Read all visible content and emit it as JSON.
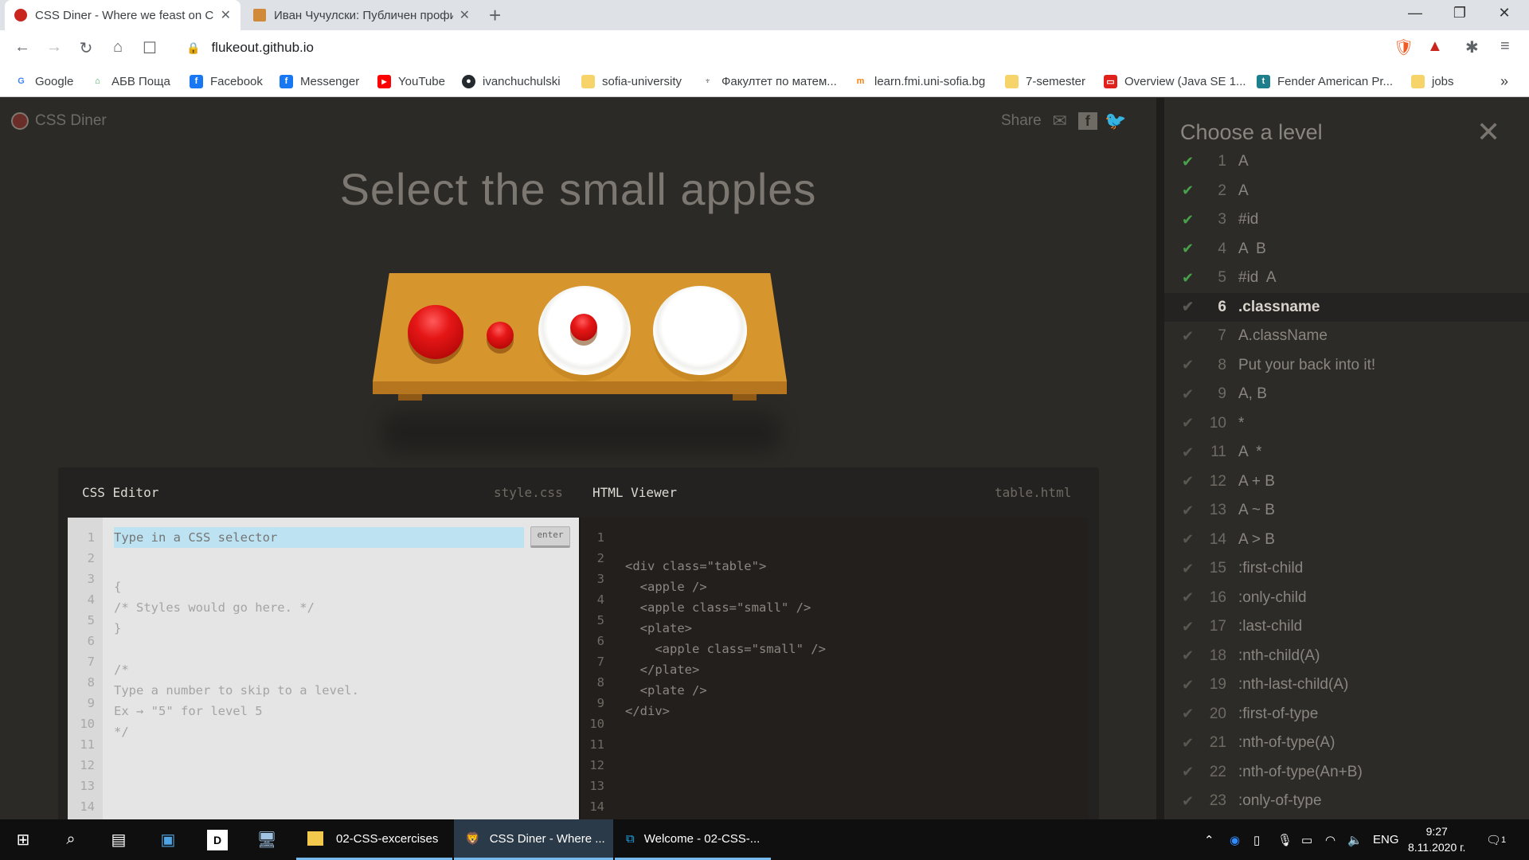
{
  "browser": {
    "tabs": [
      {
        "title": "CSS Diner - Where we feast on CSS",
        "active": true
      },
      {
        "title": "Иван Чучулски: Публичен профил",
        "active": false
      }
    ],
    "url": "flukeout.github.io",
    "bookmarks": [
      {
        "label": "Google",
        "icon": "google-icon"
      },
      {
        "label": "АБВ Поща",
        "icon": "house-icon"
      },
      {
        "label": "Facebook",
        "icon": "facebook-icon"
      },
      {
        "label": "Messenger",
        "icon": "facebook-icon"
      },
      {
        "label": "YouTube",
        "icon": "youtube-icon"
      },
      {
        "label": "ivanchuchulski",
        "icon": "github-icon"
      },
      {
        "label": "sofia-university",
        "icon": "folder-icon"
      },
      {
        "label": "Факултет по матем...",
        "icon": "university-icon"
      },
      {
        "label": "learn.fmi.uni-sofia.bg",
        "icon": "moodle-icon"
      },
      {
        "label": "7-semester",
        "icon": "folder-icon"
      },
      {
        "label": "Overview (Java SE 1...",
        "icon": "oracle-icon"
      },
      {
        "label": "Fender American Pr...",
        "icon": "tab-icon"
      },
      {
        "label": "jobs",
        "icon": "folder-icon"
      }
    ],
    "bookmarks_overflow": "»"
  },
  "page": {
    "brand": "CSS Diner",
    "share": "Share",
    "heading": "Select the small apples",
    "css_editor": {
      "title": "CSS Editor",
      "filename": "style.css",
      "placeholder": "Type in a CSS selector",
      "enter_label": "enter",
      "lines": [
        "",
        "{",
        "/* Styles would go here. */",
        "}",
        "",
        "/*",
        "Type a number to skip to a level.",
        "Ex → \"5\" for level 5",
        "*/",
        "",
        "",
        "",
        "",
        ""
      ],
      "line_numbers": [
        "1",
        "2",
        "3",
        "4",
        "5",
        "6",
        "7",
        "8",
        "9",
        "10",
        "11",
        "12",
        "13",
        "14"
      ]
    },
    "html_viewer": {
      "title": "HTML Viewer",
      "filename": "table.html",
      "lines": [
        "<div class=\"table\">",
        "  <apple />",
        "  <apple class=\"small\" />",
        "  <plate>",
        "    <apple class=\"small\" />",
        "  </plate>",
        "  <plate />",
        "</div>",
        "",
        "",
        "",
        "",
        "",
        ""
      ],
      "line_numbers": [
        "1",
        "2",
        "3",
        "4",
        "5",
        "6",
        "7",
        "8",
        "9",
        "10",
        "11",
        "12",
        "13",
        "14"
      ]
    }
  },
  "sidebar": {
    "title": "Choose a level",
    "levels": [
      {
        "num": "1",
        "label": "A",
        "done": true
      },
      {
        "num": "2",
        "label": "A",
        "done": true
      },
      {
        "num": "3",
        "label": "#id",
        "done": true
      },
      {
        "num": "4",
        "label": "A  B",
        "done": true
      },
      {
        "num": "5",
        "label": "#id  A",
        "done": true
      },
      {
        "num": "6",
        "label": ".classname",
        "done": false,
        "active": true
      },
      {
        "num": "7",
        "label": "A.className",
        "done": false
      },
      {
        "num": "8",
        "label": "Put your back into it!",
        "done": false
      },
      {
        "num": "9",
        "label": "A, B",
        "done": false
      },
      {
        "num": "10",
        "label": "*",
        "done": false
      },
      {
        "num": "11",
        "label": "A  *",
        "done": false
      },
      {
        "num": "12",
        "label": "A + B",
        "done": false
      },
      {
        "num": "13",
        "label": "A ~ B",
        "done": false
      },
      {
        "num": "14",
        "label": "A > B",
        "done": false
      },
      {
        "num": "15",
        "label": ":first-child",
        "done": false
      },
      {
        "num": "16",
        "label": ":only-child",
        "done": false
      },
      {
        "num": "17",
        "label": ":last-child",
        "done": false
      },
      {
        "num": "18",
        "label": ":nth-child(A)",
        "done": false
      },
      {
        "num": "19",
        "label": ":nth-last-child(A)",
        "done": false
      },
      {
        "num": "20",
        "label": ":first-of-type",
        "done": false
      },
      {
        "num": "21",
        "label": ":nth-of-type(A)",
        "done": false
      },
      {
        "num": "22",
        "label": ":nth-of-type(An+B)",
        "done": false
      },
      {
        "num": "23",
        "label": ":only-of-type",
        "done": false
      }
    ]
  },
  "taskbar": {
    "apps": [
      {
        "label": "02-CSS-excercises",
        "icon": "folder-icon"
      },
      {
        "label": "CSS Diner - Where ...",
        "icon": "brave-icon",
        "active": true
      },
      {
        "label": "Welcome - 02-CSS-...",
        "icon": "vscode-icon"
      }
    ],
    "lang": "ENG",
    "time": "9:27",
    "date": "8.11.2020 г.",
    "notification_count": "1"
  },
  "colors": {
    "page_bg": "#2c2a27",
    "table": "#d7962d",
    "apple": "#e51616",
    "check_done": "#47a24a",
    "input_highlight": "#bde3f2"
  }
}
